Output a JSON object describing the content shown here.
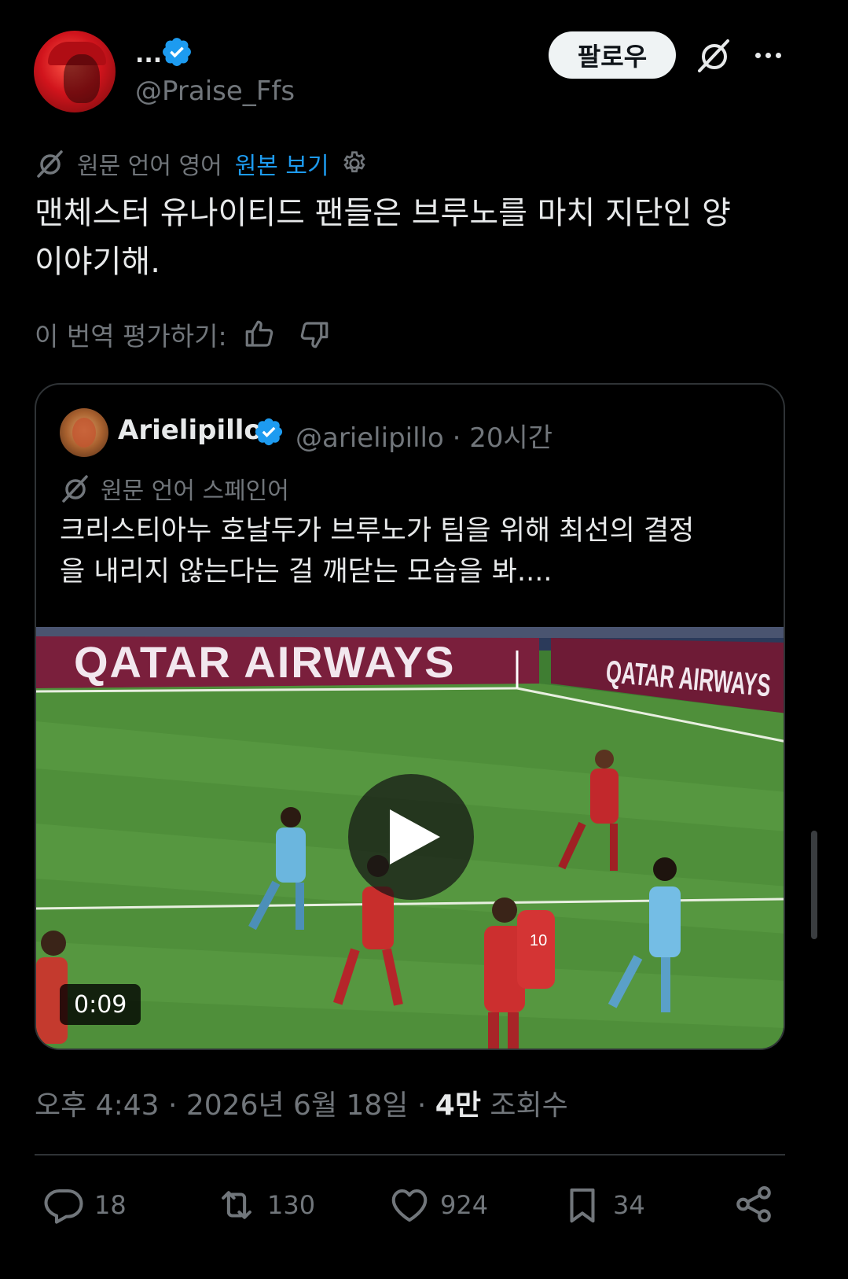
{
  "author": {
    "display_name": "...",
    "handle": "@Praise_Ffs",
    "follow_label": "팔로우"
  },
  "translation": {
    "note": "원문 언어 영어",
    "show_original": "원본 보기"
  },
  "tweet": {
    "text_line1": "맨체스터 유나이티드 팬들은 브루노를 마치 지단인 양",
    "text_line2": "이야기해."
  },
  "rating": {
    "label": "이 번역 평가하기:"
  },
  "quote": {
    "display_name": "Arielipillo",
    "handle_time": "@arielipillo · 20시간",
    "translation_note": "원문 언어 스페인어",
    "text_line1": "크리스티아누 호날두가 브루노가 팀을 위해 최선의 결정",
    "text_line2": "을 내리지 않는다는 걸 깨닫는 모습을 봐....",
    "video": {
      "duration": "0:09",
      "banner_left": "QATAR AIRWAYS",
      "banner_right": "QATAR AIRWAYS",
      "player_number": "10"
    }
  },
  "meta": {
    "time_date": "오후 4:43 · 2026년 6월 18일 · ",
    "views_count": "4만",
    "views_label": " 조회수"
  },
  "actions": {
    "replies": "18",
    "retweets": "130",
    "likes": "924",
    "bookmarks": "34"
  },
  "colors": {
    "background": "#000000",
    "accent": "#1d9bf0",
    "muted": "#71767b",
    "text": "#e7e9ea"
  }
}
